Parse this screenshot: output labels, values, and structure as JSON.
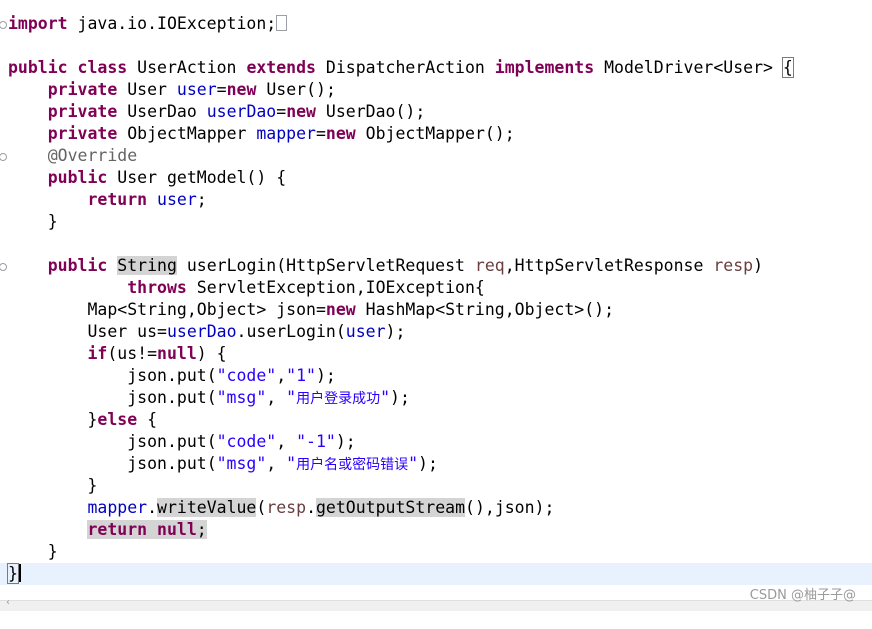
{
  "editor": {
    "line1": {
      "kw": "import",
      "text": " java.io.IOException;"
    },
    "line3": {
      "k1": "public",
      "k2": "class",
      "name": " UserAction ",
      "k3": "extends",
      "base": " DispatcherAction ",
      "k4": "implements",
      "iface": " ModelDriver<User> ",
      "brace": "{"
    },
    "line4": {
      "kw": "private",
      "t": " User ",
      "fld": "user",
      "eq": "=",
      "kw2": "new",
      "rest": " User();"
    },
    "line5": {
      "kw": "private",
      "t": " UserDao ",
      "fld": "userDao",
      "eq": "=",
      "kw2": "new",
      "rest": " UserDao();"
    },
    "line6": {
      "kw": "private",
      "t": " ObjectMapper ",
      "fld": "mapper",
      "eq": "=",
      "kw2": "new",
      "rest": " ObjectMapper();"
    },
    "line7": {
      "ann": "@Override"
    },
    "line8": {
      "kw": "public",
      "rest": " User getModel() {"
    },
    "line9": {
      "kw": "return",
      "fld": "user",
      "rest": ";"
    },
    "line10": {
      "text": "}"
    },
    "line12": {
      "kw": "public",
      "type": "String",
      "sig": " userLogin(HttpServletRequest ",
      "p1": "req",
      "mid": ",HttpServletResponse ",
      "p2": "resp",
      "end": ")"
    },
    "line13": {
      "kw": "throws",
      "rest": " ServletException,IOException{"
    },
    "line14": {
      "a": "Map<String,Object> json=",
      "kw": "new",
      "b": " HashMap<String,Object>();"
    },
    "line15": {
      "a": "User us=",
      "fld": "userDao",
      "b": ".userLogin(",
      "fld2": "user",
      "c": ");"
    },
    "line16": {
      "kw": "if",
      "a": "(us!=",
      "kw2": "null",
      "b": ") {"
    },
    "line17": {
      "a": "json.put(",
      "s1": "\"code\"",
      "b": ",",
      "s2": "\"1\"",
      "c": ");"
    },
    "line18": {
      "a": "json.put(",
      "s1": "\"msg\"",
      "b": ", ",
      "s2a": "\"",
      "s2": "用户登录成功",
      "s2b": "\"",
      "c": ");"
    },
    "line19": {
      "a": "}",
      "kw": "else",
      "b": " {"
    },
    "line20": {
      "a": "json.put(",
      "s1": "\"code\"",
      "b": ", ",
      "s2": "\"-1\"",
      "c": ");"
    },
    "line21": {
      "a": "json.put(",
      "s1": "\"msg\"",
      "b": ", ",
      "s2a": "\"",
      "s2": "用户名或密码错误",
      "s2b": "\"",
      "c": ");"
    },
    "line22": {
      "text": "}"
    },
    "line23": {
      "fld": "mapper",
      "a": ".",
      "m1": "writeValue",
      "b": "(",
      "p": "resp",
      "c": ".",
      "m2": "getOutputStream",
      "d": "(),json);"
    },
    "line24": {
      "kw": "return",
      "kw2": "null",
      "a": ";"
    },
    "line25": {
      "text": "}"
    },
    "line26": {
      "text": "}"
    }
  },
  "watermark": "CSDN @柚子子@"
}
